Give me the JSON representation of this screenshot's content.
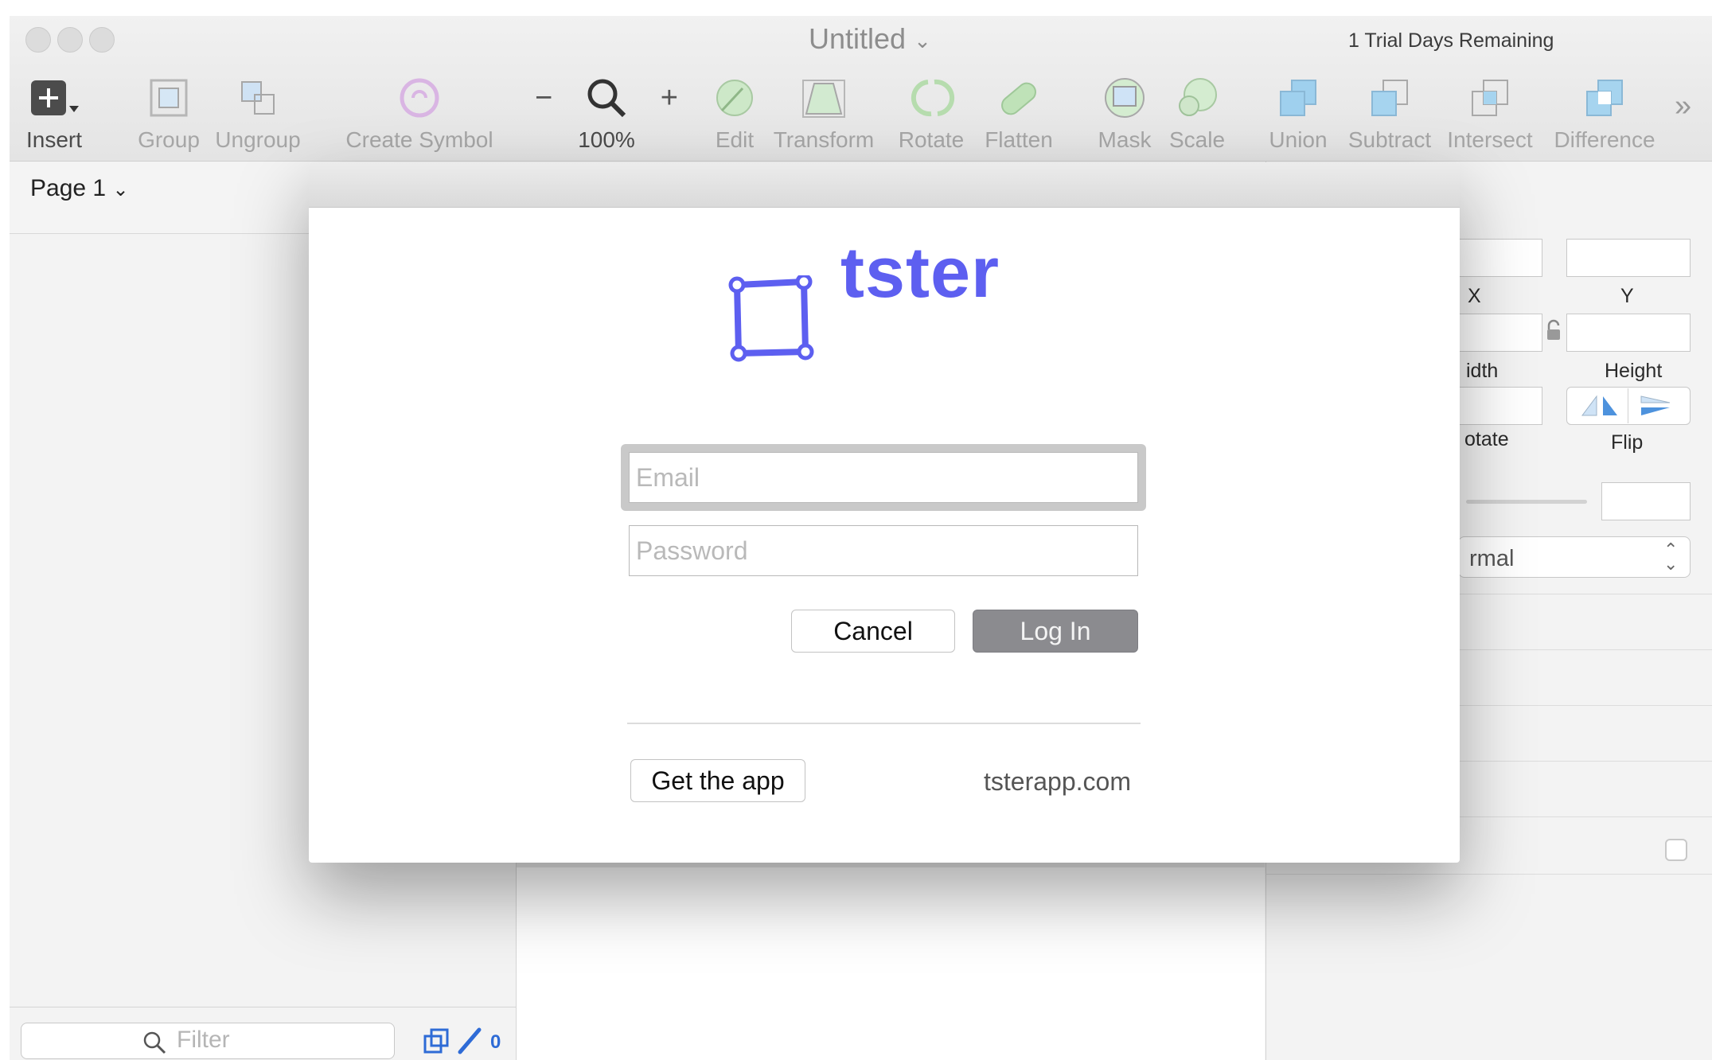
{
  "window": {
    "title": "Untitled",
    "trial_text": "1 Trial Days Remaining"
  },
  "toolbar": {
    "insert": "Insert",
    "group": "Group",
    "ungroup": "Ungroup",
    "create_symbol": "Create Symbol",
    "zoom_level": "100%",
    "edit": "Edit",
    "transform": "Transform",
    "rotate": "Rotate",
    "flatten": "Flatten",
    "mask": "Mask",
    "scale": "Scale",
    "union": "Union",
    "subtract": "Subtract",
    "intersect": "Intersect",
    "difference": "Difference",
    "zoom_minus": "−",
    "zoom_plus": "+"
  },
  "page_selector": {
    "label": "Page 1"
  },
  "layers": {
    "filter_placeholder": "Filter",
    "count": "0"
  },
  "inspector": {
    "x_label": "X",
    "y_label": "Y",
    "width_label": "idth",
    "height_label": "Height",
    "rotate_label": "otate",
    "flip_label": "Flip",
    "blend_mode": "rmal"
  },
  "login_modal": {
    "brand": "tster",
    "email_placeholder": "Email",
    "password_placeholder": "Password",
    "cancel_label": "Cancel",
    "login_label": "Log In",
    "get_app_label": "Get the app",
    "site_link": "tsterapp.com",
    "brand_color": "#5d5ff0"
  }
}
